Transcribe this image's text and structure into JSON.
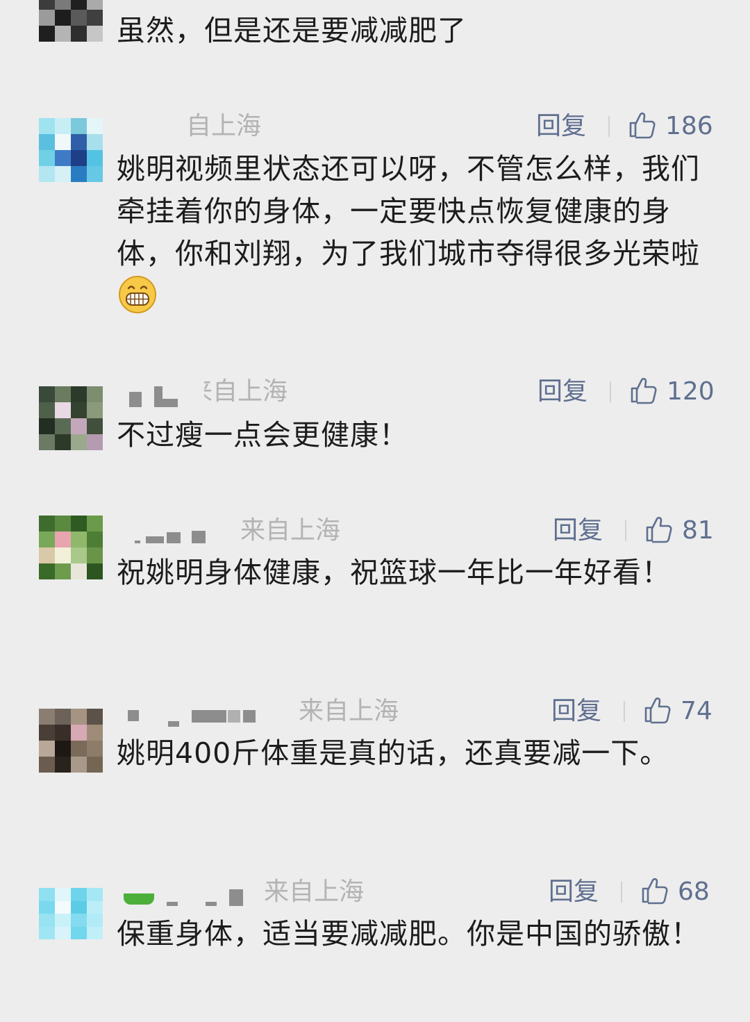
{
  "comments": [
    {
      "location": "",
      "text": "虽然，但是还是要减减肥了"
    },
    {
      "location": "自上海",
      "reply_label": "回复",
      "likes": "186",
      "text": "姚明视频里状态还可以呀，不管怎么样，我们牵挂着你的身体，一定要快点恢复健康的身体，你和刘翔，为了我们城市夺得很多光荣啦",
      "emoji": "grinning-face-emoji"
    },
    {
      "location": "来自上海",
      "reply_label": "回复",
      "likes": "120",
      "text": "不过瘦一点会更健康！"
    },
    {
      "location": "来自上海",
      "reply_label": "回复",
      "likes": "81",
      "text": "祝姚明身体健康，祝篮球一年比一年好看！"
    },
    {
      "location": "来自上海",
      "reply_label": "回复",
      "likes": "74",
      "text": "姚明400斤体重是真的话，还真要减一下。"
    },
    {
      "location": "来自上海",
      "reply_label": "回复",
      "likes": "68",
      "text": "保重身体，适当要减减肥。你是中国的骄傲！"
    }
  ],
  "icons": {
    "like": "thumbs-up-icon",
    "emoji": "grinning-face-emoji"
  },
  "colors": {
    "background": "#ededed",
    "text": "#1c1c1c",
    "meta": "#b3b3b3",
    "action": "#5f6f8f",
    "emoji_fill": "#f7c948"
  }
}
